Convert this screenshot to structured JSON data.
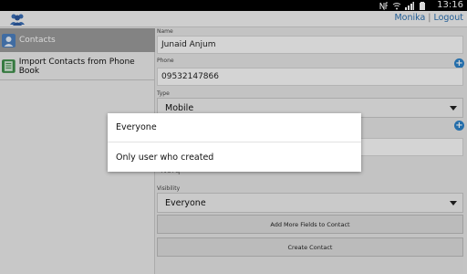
{
  "status_bar": {
    "time": "13:16",
    "icons": [
      "nfc-icon",
      "wifi-icon",
      "signal-icon",
      "battery-icon"
    ]
  },
  "action_bar": {
    "app_icon": "contacts-people-icon",
    "user_name": "Monika",
    "separator": "|",
    "logout": "Logout"
  },
  "sidebar": {
    "items": [
      {
        "label": "Contacts",
        "icon": "contacts-app-icon",
        "active": true
      },
      {
        "label": "Import Contacts from Phone Book",
        "icon": "phonebook-icon",
        "active": false
      }
    ]
  },
  "form": {
    "name_label": "Name",
    "name_value": "Junaid Anjum",
    "phone_label": "Phone",
    "phone_value": "09532147866",
    "type_label": "Type",
    "type_value": "Mobile",
    "obscured_value": "Norq",
    "visibility_label": "Visibility",
    "visibility_value": "Everyone",
    "add_more_button": "Add More Fields to Contact",
    "create_button": "Create Contact"
  },
  "dialog": {
    "options": [
      "Everyone",
      "Only user who created"
    ]
  },
  "colors": {
    "accent": "#2b82c9",
    "link": "#2a6fb0",
    "active_sidebar": "#9a9a9a"
  }
}
